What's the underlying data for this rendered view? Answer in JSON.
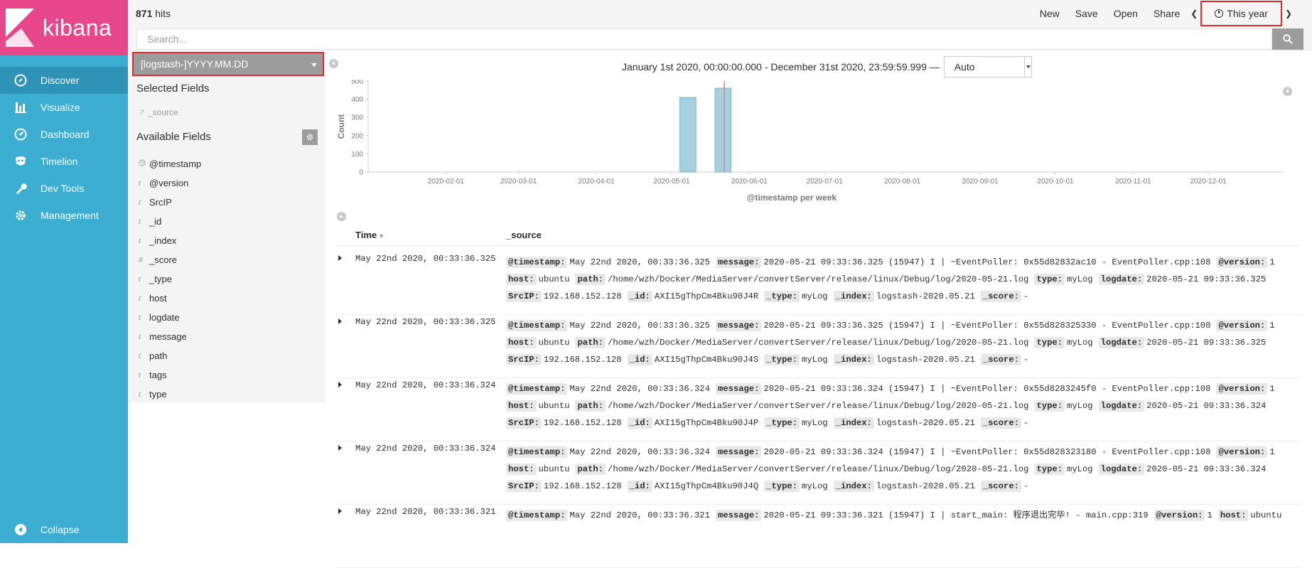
{
  "nav": {
    "logo_text": "kibana",
    "items": [
      {
        "label": "Discover",
        "icon": "compass-icon",
        "active": true
      },
      {
        "label": "Visualize",
        "icon": "bar-chart-icon",
        "active": false
      },
      {
        "label": "Dashboard",
        "icon": "dashboard-gauge-icon",
        "active": false
      },
      {
        "label": "Timelion",
        "icon": "timelion-mask-icon",
        "active": false
      },
      {
        "label": "Dev Tools",
        "icon": "wrench-icon",
        "active": false
      },
      {
        "label": "Management",
        "icon": "gear-icon",
        "active": false
      }
    ],
    "collapse_label": "Collapse"
  },
  "topbar": {
    "hits_count": "871",
    "hits_label": "hits",
    "menu": [
      "New",
      "Save",
      "Open",
      "Share"
    ],
    "time_label": "This year"
  },
  "search": {
    "placeholder": "Search..."
  },
  "sidebar": {
    "index_pattern": "[logstash-]YYYY.MM.DD",
    "selected_title": "Selected Fields",
    "selected_fields": [
      {
        "type": "?",
        "name": "_source"
      }
    ],
    "available_title": "Available Fields",
    "available_fields": [
      {
        "type": "clock",
        "name": "@timestamp"
      },
      {
        "type": "t",
        "name": "@version"
      },
      {
        "type": "t",
        "name": "SrcIP"
      },
      {
        "type": "t",
        "name": "_id"
      },
      {
        "type": "t",
        "name": "_index"
      },
      {
        "type": "#",
        "name": "_score"
      },
      {
        "type": "t",
        "name": "_type"
      },
      {
        "type": "t",
        "name": "host"
      },
      {
        "type": "t",
        "name": "logdate"
      },
      {
        "type": "t",
        "name": "message"
      },
      {
        "type": "t",
        "name": "path"
      },
      {
        "type": "t",
        "name": "tags"
      },
      {
        "type": "t",
        "name": "type"
      }
    ]
  },
  "histogram": {
    "range_text": "January 1st 2020, 00:00:00.000 - December 31st 2020, 23:59:59.999 —",
    "interval": "Auto"
  },
  "chart_data": {
    "type": "bar",
    "ylabel": "Count",
    "xlabel": "@timestamp per week",
    "ylim": [
      0,
      500
    ],
    "yticks": [
      0,
      100,
      200,
      300,
      400,
      500
    ],
    "xticks": [
      "2020-02-01",
      "2020-03-01",
      "2020-04-01",
      "2020-05-01",
      "2020-06-01",
      "2020-07-01",
      "2020-08-01",
      "2020-09-01",
      "2020-10-01",
      "2020-11-01",
      "2020-12-01"
    ],
    "x_domain": [
      "2020-01-01",
      "2020-12-31"
    ],
    "series": [
      {
        "values": [
          {
            "week_start": "2020-05-04",
            "count": 410
          },
          {
            "week_start": "2020-05-18",
            "count": 461
          }
        ]
      }
    ],
    "now_marker": "2020-05-22",
    "bar_color": "#a4d0e0",
    "marker_color": "#e97c7c"
  },
  "table": {
    "col_time": "Time",
    "col_source": "_source",
    "rows": [
      {
        "time": "May 22nd 2020, 00:33:36.325",
        "lines": [
          [
            [
              "@timestamp:",
              "May 22nd 2020, 00:33:36.325"
            ],
            [
              "message:",
              "2020-05-21 09:33:36.325 (15947) I | ~EventPoller: 0x55d82832ac10 - EventPoller.cpp:108"
            ],
            [
              "@version:",
              "1"
            ]
          ],
          [
            [
              "host:",
              "ubuntu"
            ],
            [
              "path:",
              "/home/wzh/Docker/MediaServer/convertServer/release/linux/Debug/log/2020-05-21.log"
            ],
            [
              "type:",
              "myLog"
            ],
            [
              "logdate:",
              "2020-05-21 09:33:36.325"
            ]
          ],
          [
            [
              "SrcIP:",
              "192.168.152.128"
            ],
            [
              "_id:",
              "AXI15gThpCm4Bku90J4R"
            ],
            [
              "_type:",
              "myLog"
            ],
            [
              "_index:",
              "logstash-2020.05.21"
            ],
            [
              "_score:",
              "-"
            ]
          ]
        ]
      },
      {
        "time": "May 22nd 2020, 00:33:36.325",
        "lines": [
          [
            [
              "@timestamp:",
              "May 22nd 2020, 00:33:36.325"
            ],
            [
              "message:",
              "2020-05-21 09:33:36.325 (15947) I | ~EventPoller: 0x55d828325330 - EventPoller.cpp:108"
            ],
            [
              "@version:",
              "1"
            ]
          ],
          [
            [
              "host:",
              "ubuntu"
            ],
            [
              "path:",
              "/home/wzh/Docker/MediaServer/convertServer/release/linux/Debug/log/2020-05-21.log"
            ],
            [
              "type:",
              "myLog"
            ],
            [
              "logdate:",
              "2020-05-21 09:33:36.325"
            ]
          ],
          [
            [
              "SrcIP:",
              "192.168.152.128"
            ],
            [
              "_id:",
              "AXI15gThpCm4Bku90J4S"
            ],
            [
              "_type:",
              "myLog"
            ],
            [
              "_index:",
              "logstash-2020.05.21"
            ],
            [
              "_score:",
              "-"
            ]
          ]
        ]
      },
      {
        "time": "May 22nd 2020, 00:33:36.324",
        "lines": [
          [
            [
              "@timestamp:",
              "May 22nd 2020, 00:33:36.324"
            ],
            [
              "message:",
              "2020-05-21 09:33:36.324 (15947) I | ~EventPoller: 0x55d8283245f0 - EventPoller.cpp:108"
            ],
            [
              "@version:",
              "1"
            ]
          ],
          [
            [
              "host:",
              "ubuntu"
            ],
            [
              "path:",
              "/home/wzh/Docker/MediaServer/convertServer/release/linux/Debug/log/2020-05-21.log"
            ],
            [
              "type:",
              "myLog"
            ],
            [
              "logdate:",
              "2020-05-21 09:33:36.324"
            ]
          ],
          [
            [
              "SrcIP:",
              "192.168.152.128"
            ],
            [
              "_id:",
              "AXI15gThpCm4Bku90J4P"
            ],
            [
              "_type:",
              "myLog"
            ],
            [
              "_index:",
              "logstash-2020.05.21"
            ],
            [
              "_score:",
              "-"
            ]
          ]
        ]
      },
      {
        "time": "May 22nd 2020, 00:33:36.324",
        "lines": [
          [
            [
              "@timestamp:",
              "May 22nd 2020, 00:33:36.324"
            ],
            [
              "message:",
              "2020-05-21 09:33:36.324 (15947) I | ~EventPoller: 0x55d828323180 - EventPoller.cpp:108"
            ],
            [
              "@version:",
              "1"
            ]
          ],
          [
            [
              "host:",
              "ubuntu"
            ],
            [
              "path:",
              "/home/wzh/Docker/MediaServer/convertServer/release/linux/Debug/log/2020-05-21.log"
            ],
            [
              "type:",
              "myLog"
            ],
            [
              "logdate:",
              "2020-05-21 09:33:36.324"
            ]
          ],
          [
            [
              "SrcIP:",
              "192.168.152.128"
            ],
            [
              "_id:",
              "AXI15gThpCm4Bku90J4Q"
            ],
            [
              "_type:",
              "myLog"
            ],
            [
              "_index:",
              "logstash-2020.05.21"
            ],
            [
              "_score:",
              "-"
            ]
          ]
        ]
      },
      {
        "time": "May 22nd 2020, 00:33:36.321",
        "lines": [
          [
            [
              "@timestamp:",
              "May 22nd 2020, 00:33:36.321"
            ],
            [
              "message:",
              "2020-05-21 09:33:36.321 (15947) I | start_main: 程序退出完毕! - main.cpp:319"
            ],
            [
              "@version:",
              "1"
            ],
            [
              "host:",
              "ubuntu"
            ]
          ]
        ]
      }
    ]
  },
  "colors": {
    "nav_bg": "#3caed2",
    "nav_active": "#2e93b6",
    "logo_bg": "#e8488b",
    "highlight": "#e02a2a"
  }
}
